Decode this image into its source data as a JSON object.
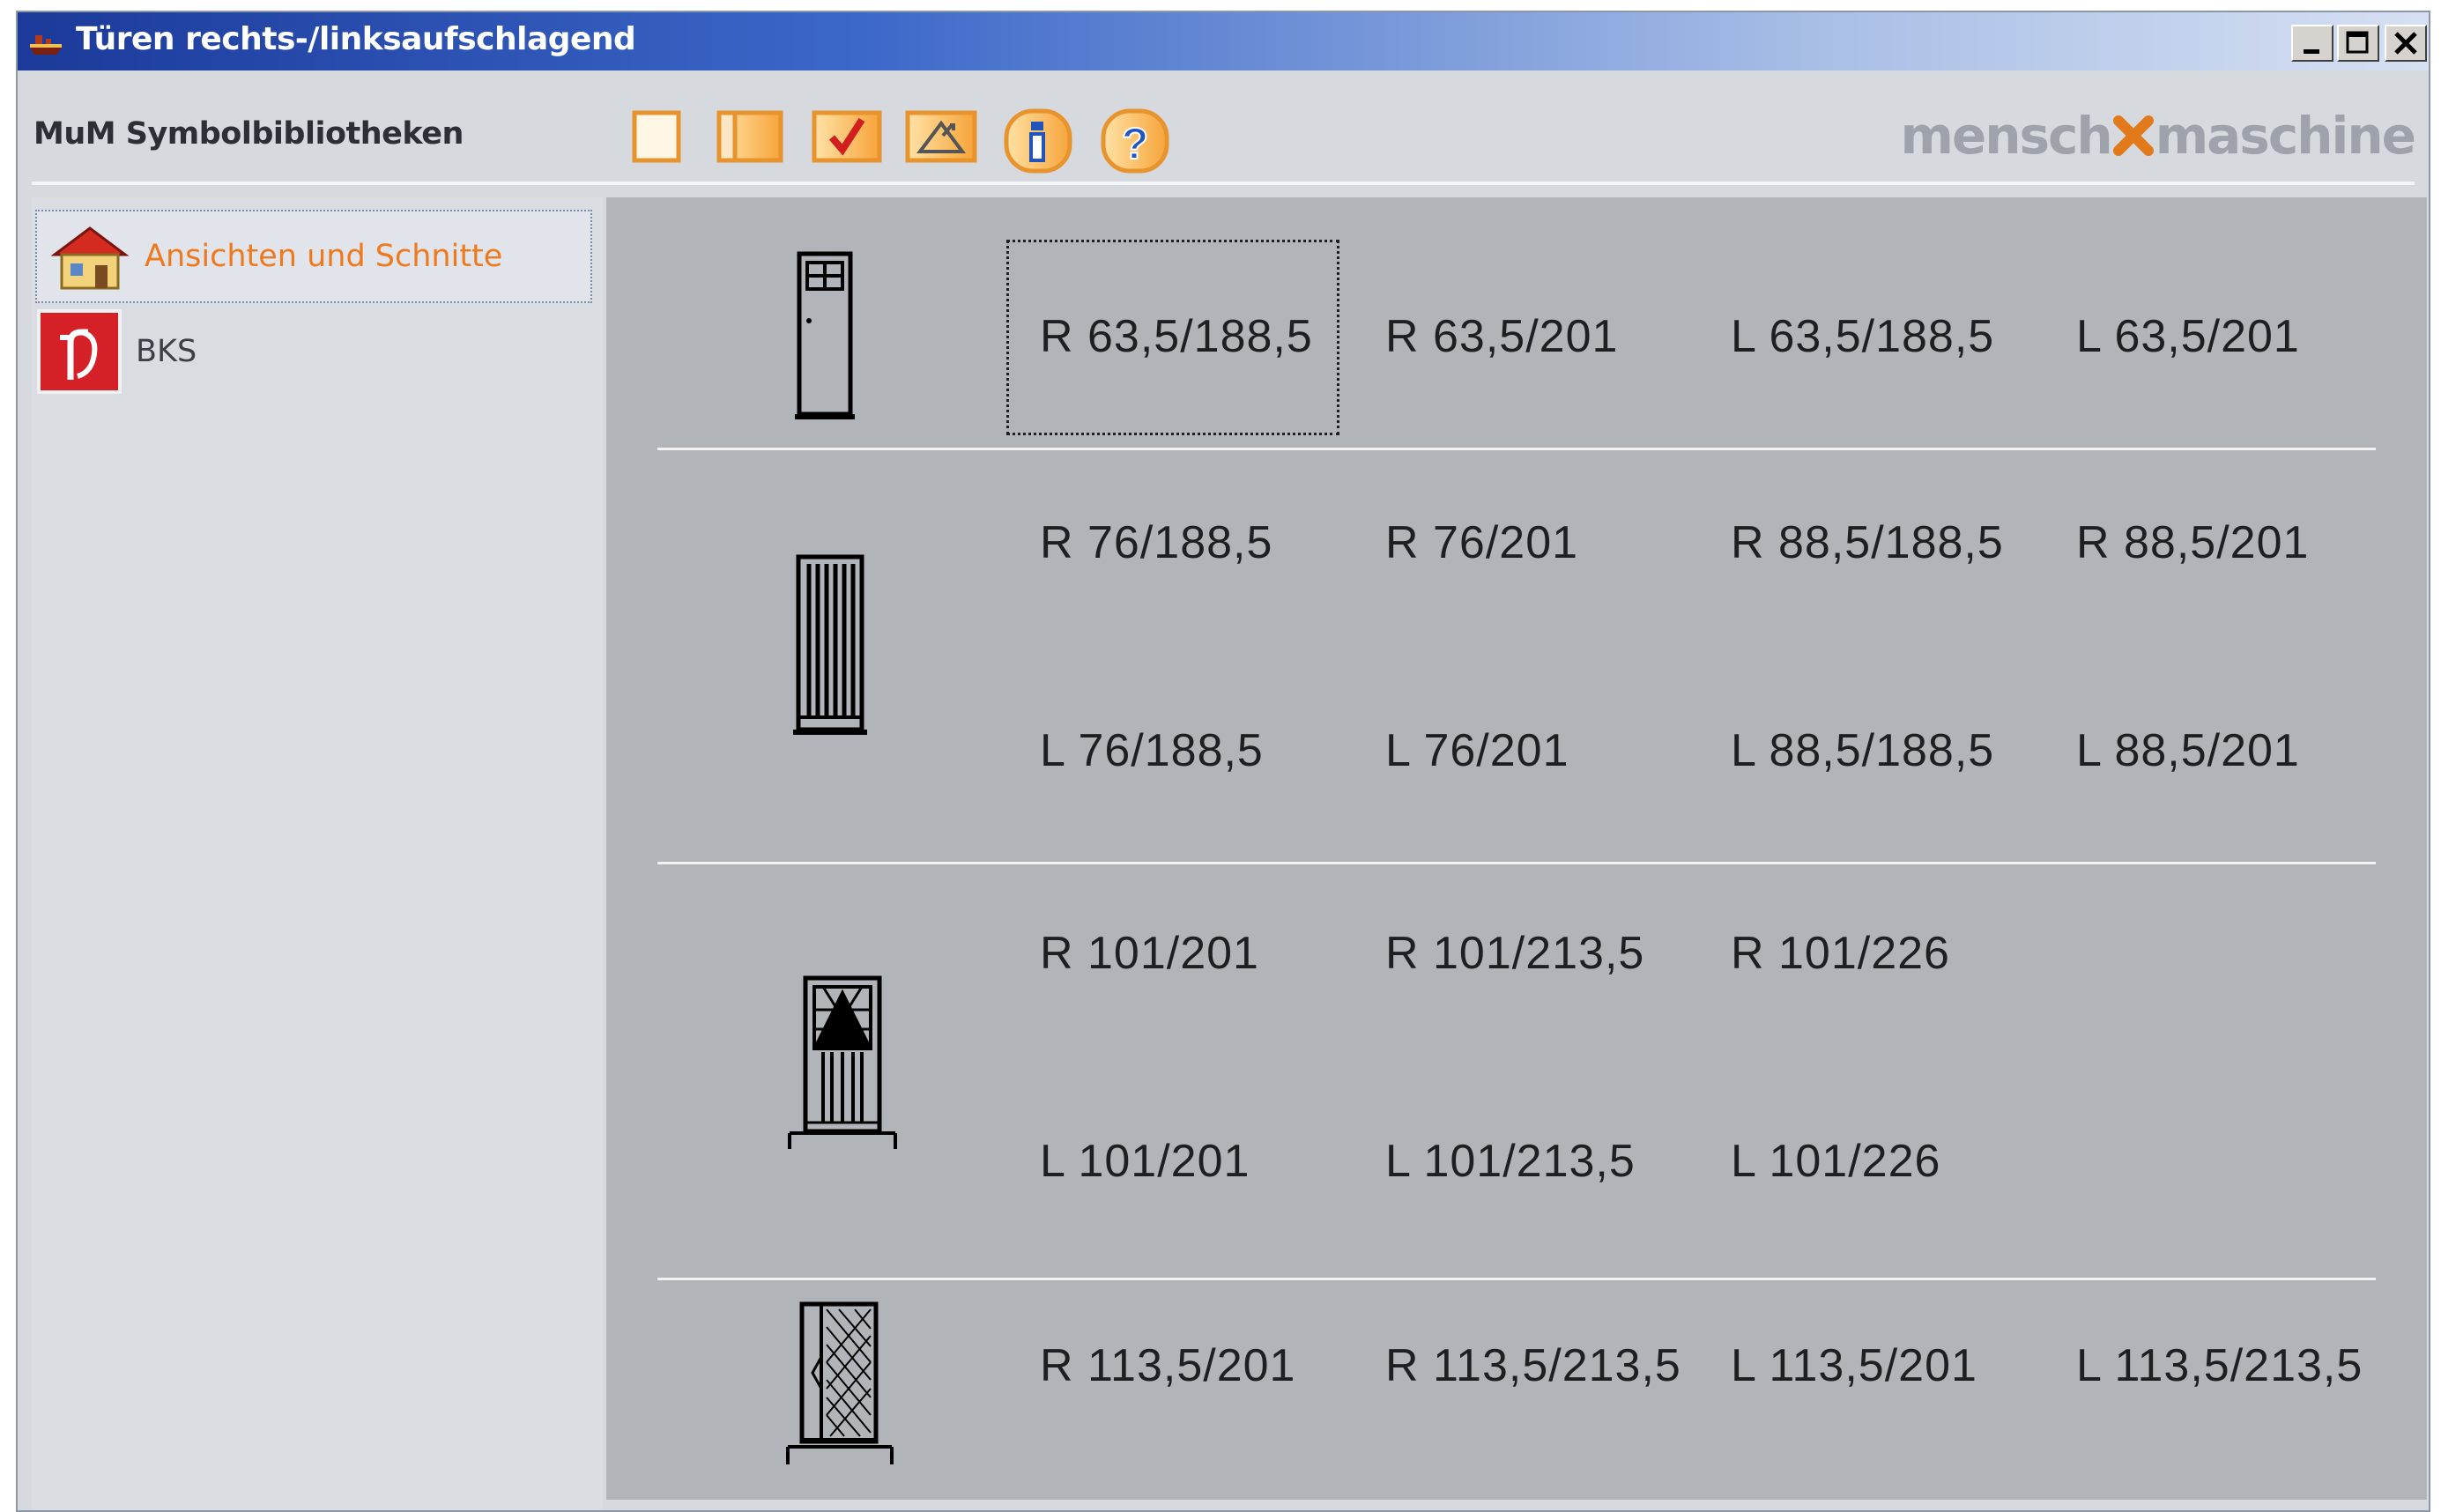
{
  "window": {
    "title": "Türen rechts-/linksaufschlagend",
    "title_icon": "ship-icon",
    "controls": [
      "minimize",
      "maximize",
      "close"
    ]
  },
  "toolbar": {
    "label": "MuM Symbolbibliotheken",
    "buttons": [
      "blank-page-icon",
      "book-icon",
      "checkmark-icon",
      "warning-house-icon",
      "info-icon",
      "help-icon"
    ],
    "brand_left": "mensch",
    "brand_right": "maschine",
    "brand_accent": "#e27a1c"
  },
  "sidebar": {
    "items": [
      {
        "label": "Ansichten und Schnitte",
        "icon": "house-icon",
        "selected": true
      },
      {
        "label": "BKS",
        "icon": "fire-extinguisher-icon",
        "selected": false
      }
    ]
  },
  "groups": [
    {
      "icon": "door-window-icon",
      "labels": [
        "R 63,5/188,5",
        "R 63,5/201",
        "L 63,5/188,5",
        "L 63,5/201"
      ]
    },
    {
      "icon": "door-striped-icon",
      "labels": [
        "R 76/188,5",
        "R 76/201",
        "R 88,5/188,5",
        "R 88,5/201",
        "L 76/188,5",
        "L 76/201",
        "L 88,5/188,5",
        "L 88,5/201"
      ]
    },
    {
      "icon": "door-ornamental-icon",
      "labels": [
        "R 101/201",
        "R 101/213,5",
        "R 101/226",
        "L 101/201",
        "L 101/213,5",
        "L 101/226"
      ]
    },
    {
      "icon": "door-sidelight-icon",
      "labels": [
        "R 113,5/201",
        "R 113,5/213,5",
        "L 113,5/201",
        "L 113,5/213,5"
      ]
    }
  ],
  "focused_label": "R 63,5/188,5"
}
